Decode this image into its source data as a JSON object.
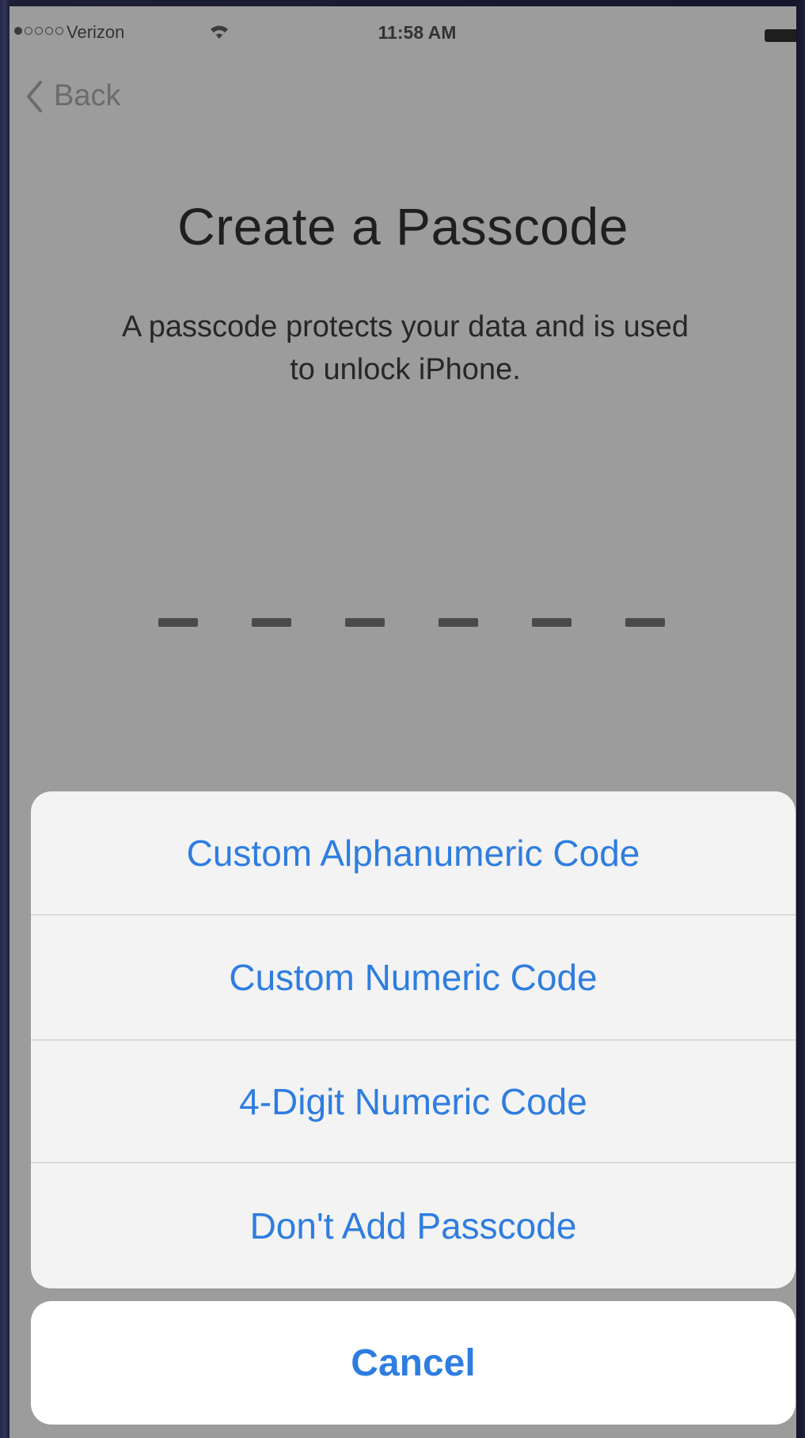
{
  "status_bar": {
    "carrier": "Verizon",
    "time": "11:58 AM",
    "signal_filled": 1,
    "signal_total": 5
  },
  "nav": {
    "back_label": "Back"
  },
  "screen": {
    "title": "Create a Passcode",
    "subtitle_line1": "A passcode protects your data and is used",
    "subtitle_line2": "to unlock iPhone.",
    "passcode_length": 6
  },
  "action_sheet": {
    "options": [
      "Custom Alphanumeric Code",
      "Custom Numeric Code",
      "4-Digit Numeric Code",
      "Don't Add Passcode"
    ],
    "cancel_label": "Cancel"
  },
  "colors": {
    "accent": "#2e7de0",
    "dim_background": "#9c9c9c",
    "sheet_background": "#f3f3f3"
  }
}
